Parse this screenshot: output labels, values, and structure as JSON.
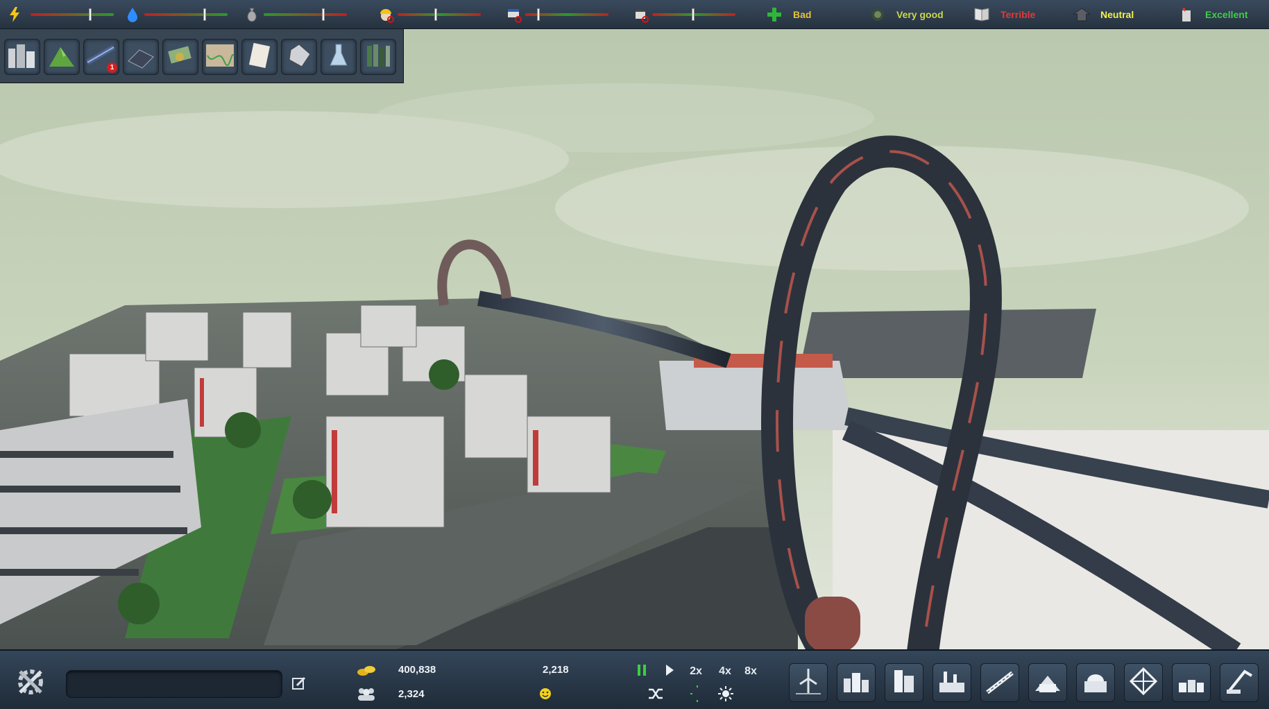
{
  "top_bar": {
    "meters": [
      {
        "name": "power",
        "icon": "lightning-icon",
        "level": 0.72
      },
      {
        "name": "water",
        "icon": "water-drop-icon",
        "level": 0.73
      },
      {
        "name": "waste",
        "icon": "garbage-bag-icon",
        "level": 0.72
      },
      {
        "name": "jobs",
        "icon": "worker-helmet-icon",
        "level": 0.46
      },
      {
        "name": "education",
        "icon": "education-icon",
        "level": 0.15
      },
      {
        "name": "police",
        "icon": "police-icon",
        "level": 0.49
      }
    ],
    "ratings": [
      {
        "name": "health",
        "icon": "health-cross-icon",
        "value": "Bad",
        "color": "#e6c23a"
      },
      {
        "name": "environment",
        "icon": "environment-icon",
        "value": "Very good",
        "color": "#c9d84a"
      },
      {
        "name": "culture",
        "icon": "book-icon",
        "value": "Terrible",
        "color": "#e03a3a"
      },
      {
        "name": "crime",
        "icon": "criminal-icon",
        "value": "Neutral",
        "color": "#f2f24a"
      },
      {
        "name": "fire",
        "icon": "fire-safety-icon",
        "value": "Excellent",
        "color": "#3fce4a"
      }
    ]
  },
  "toolbox": {
    "tools": [
      {
        "name": "city-overview",
        "icon": "city-overview-icon"
      },
      {
        "name": "terrain",
        "icon": "terrain-icon"
      },
      {
        "name": "transport",
        "icon": "transport-icon",
        "badge": "1"
      },
      {
        "name": "solar",
        "icon": "solar-panel-icon"
      },
      {
        "name": "finance",
        "icon": "money-icon"
      },
      {
        "name": "statistics",
        "icon": "chart-icon"
      },
      {
        "name": "policies",
        "icon": "document-icon"
      },
      {
        "name": "resources",
        "icon": "crystal-icon"
      },
      {
        "name": "research",
        "icon": "flask-icon"
      },
      {
        "name": "library",
        "icon": "books-icon"
      }
    ]
  },
  "bottom_bar": {
    "city_name": "",
    "money": "400,838",
    "population": "2,324",
    "happiness": "2,218",
    "speed_buttons": [
      "2x",
      "4x",
      "8x"
    ],
    "build_categories": [
      {
        "name": "power-plants",
        "icon": "wind-turbine-icon"
      },
      {
        "name": "residential",
        "icon": "residential-icon"
      },
      {
        "name": "commercial",
        "icon": "commercial-icon"
      },
      {
        "name": "industrial",
        "icon": "industrial-icon"
      },
      {
        "name": "roads",
        "icon": "road-icon"
      },
      {
        "name": "services",
        "icon": "services-icon"
      },
      {
        "name": "government",
        "icon": "government-icon"
      },
      {
        "name": "landmarks",
        "icon": "landmark-icon"
      },
      {
        "name": "parks",
        "icon": "park-icon"
      },
      {
        "name": "bulldoze",
        "icon": "crane-icon"
      }
    ]
  }
}
